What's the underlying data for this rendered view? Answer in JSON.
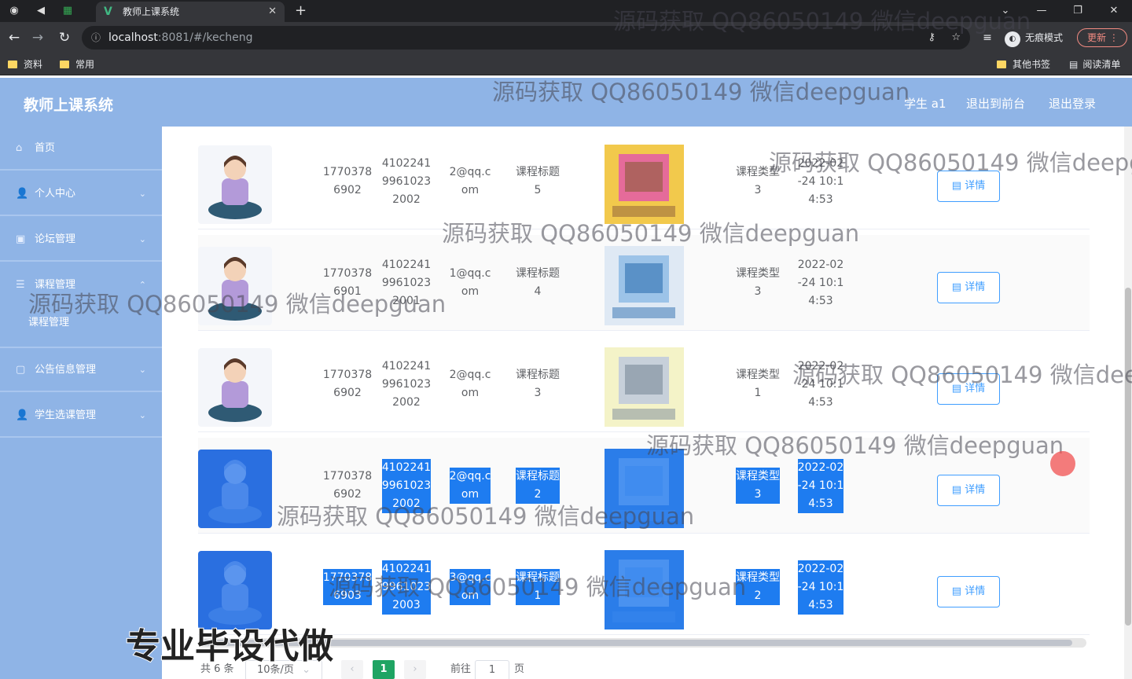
{
  "browser": {
    "tab_title": "教师上课系统",
    "url_host": "localhost",
    "url_rest": ":8081/#/kecheng",
    "incognito_label": "无痕模式",
    "update_label": "更新",
    "bookmarks": [
      "资料",
      "常用"
    ],
    "bookmarks_right": [
      "其他书签",
      "阅读清单"
    ]
  },
  "header": {
    "title": "教师上课系统",
    "user": "学生 a1",
    "back_link": "退出到前台",
    "logout": "退出登录"
  },
  "sidebar": {
    "items": [
      {
        "label": "首页",
        "icon": "home-icon"
      },
      {
        "label": "个人中心",
        "icon": "user-icon"
      },
      {
        "label": "论坛管理",
        "icon": "forum-icon"
      },
      {
        "label": "课程管理",
        "icon": "menu-icon"
      },
      {
        "label": "公告信息管理",
        "icon": "notice-icon"
      },
      {
        "label": "学生选课管理",
        "icon": "user-icon"
      }
    ],
    "submenu_label": "课程管理"
  },
  "table": {
    "detail_label": "详情",
    "rows": [
      {
        "phone": "1770378\n6902",
        "idcard": "4102241\n9961023\n2002",
        "email": "2@qq.c\nom",
        "course_title": "课程标题\n5",
        "course_type": "课程类型\n3",
        "time": "2022-02\n-24 10:1\n4:53",
        "selected": false
      },
      {
        "phone": "1770378\n6901",
        "idcard": "4102241\n9961023\n2001",
        "email": "1@qq.c\nom",
        "course_title": "课程标题\n4",
        "course_type": "课程类型\n3",
        "time": "2022-02\n-24 10:1\n4:53",
        "selected": false
      },
      {
        "phone": "1770378\n6902",
        "idcard": "4102241\n9961023\n2002",
        "email": "2@qq.c\nom",
        "course_title": "课程标题\n3",
        "course_type": "课程类型\n1",
        "time": "2022-02\n-24 10:1\n4:53",
        "selected": false
      },
      {
        "phone": "1770378\n6902",
        "idcard": "4102241\n9961023\n2002",
        "email": "2@qq.c\nom",
        "course_title": "课程标题\n2",
        "course_type": "课程类型\n3",
        "time": "2022-02\n-24 10:1\n4:53",
        "selected": true
      },
      {
        "phone": "1770378\n6903",
        "idcard": "4102241\n9961023\n2003",
        "email": "3@qq.c\nom",
        "course_title": "课程标题\n1",
        "course_type": "课程类型\n2",
        "time": "2022-02\n-24 10:1\n4:53",
        "selected": true
      }
    ]
  },
  "pagination": {
    "total": "共 6 条",
    "page_size": "10条/页",
    "current_page": "1",
    "goto_label": "前往",
    "goto_value": "1",
    "page_suffix": "页"
  },
  "overlay": {
    "watermark": "源码获取 QQ86050149 微信deepguan",
    "promo": "专业毕设代做"
  },
  "colors": {
    "header_bg": "#8fb4e6",
    "accent": "#409eff",
    "selection": "#1e7cf0",
    "active_page": "#1fa463"
  }
}
